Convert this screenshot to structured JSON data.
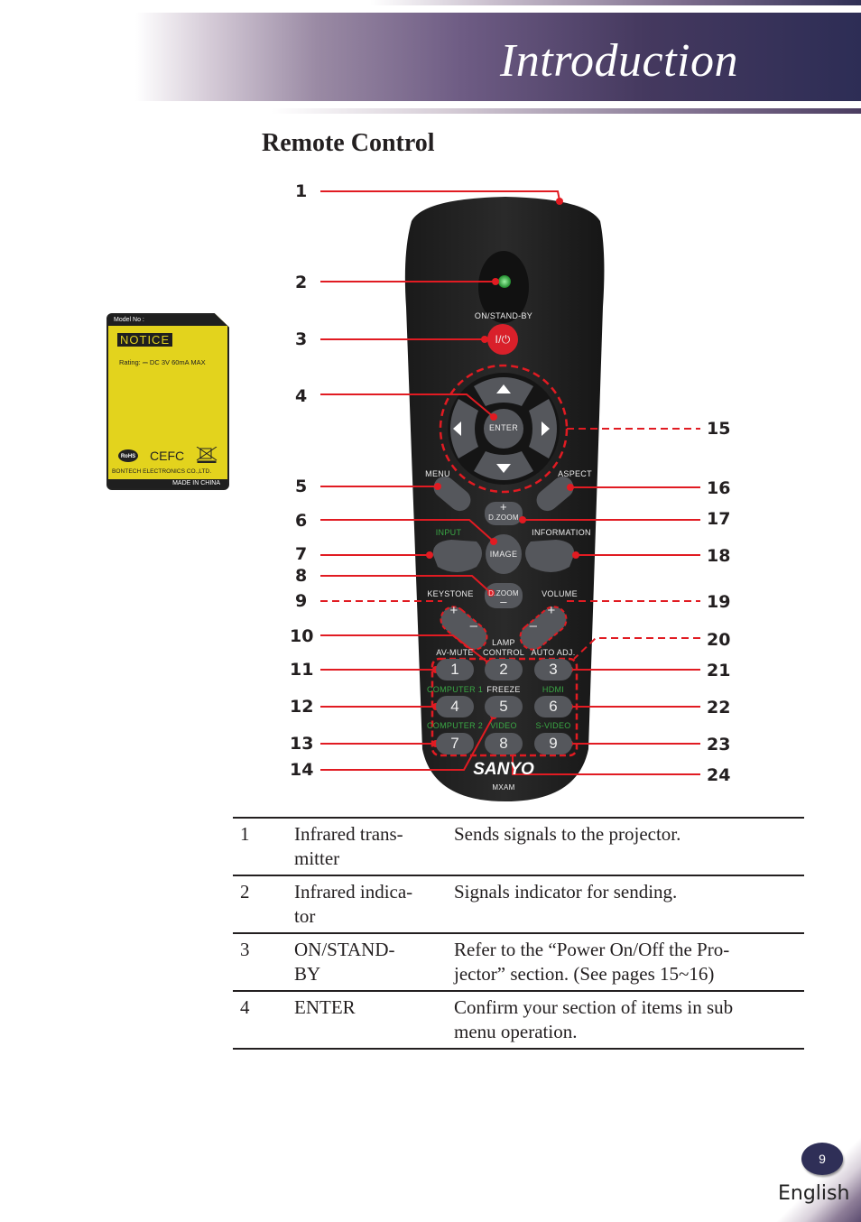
{
  "header": {
    "title": "Introduction"
  },
  "section": {
    "title": "Remote Control"
  },
  "notice_label": {
    "model_no": "Model No :",
    "notice": "NOTICE",
    "rating": "Rating: ⎓ DC 3V 60mA MAX",
    "company": "BONTECH  ELECTRONICS CO.,LTD.",
    "made_in": "MADE IN CHINA",
    "logos": [
      "RoHS",
      "CE",
      "FC",
      "WEEE bin"
    ]
  },
  "remote": {
    "power_label": "ON/STAND-BY",
    "power_symbol": "I/⏻",
    "enter": "ENTER",
    "menu": "MENU",
    "aspect": "ASPECT",
    "dzoom_plus": "D.ZOOM",
    "input": "INPUT",
    "image": "IMAGE",
    "information": "INFORMATION",
    "dzoom_minus": "D.ZOOM",
    "keystone": "KEYSTONE",
    "volume": "VOLUME",
    "lamp1": "LAMP",
    "lamp2": "CONTROL",
    "av_mute": "AV-MUTE",
    "auto_adj": "AUTO ADJ.",
    "computer1": "COMPUTER 1",
    "freeze": "FREEZE",
    "hdmi": "HDMI",
    "computer2": "COMPUTER 2",
    "video": "VIDEO",
    "svideo": "S-VIDEO",
    "digits": [
      "1",
      "2",
      "3",
      "4",
      "5",
      "6",
      "7",
      "8",
      "9"
    ],
    "brand": "SANYO",
    "model": "MXAM",
    "plus": "+",
    "minus": "–"
  },
  "callouts": {
    "left": [
      "1",
      "2",
      "3",
      "4",
      "5",
      "6",
      "7",
      "8",
      "9",
      "10",
      "11",
      "12",
      "13",
      "14"
    ],
    "right": [
      "15",
      "16",
      "17",
      "18",
      "19",
      "20",
      "21",
      "22",
      "23",
      "24"
    ]
  },
  "table": {
    "rows": [
      {
        "num": "1",
        "name": "Infrared trans-\nmitter",
        "desc": "Sends signals to the projector."
      },
      {
        "num": "2",
        "name": "Infrared indica-\ntor",
        "desc": "Signals indicator for sending."
      },
      {
        "num": "3",
        "name": "ON/STAND-\nBY",
        "desc": "Refer to the “Power On/Off the Pro-\njector” section. (See pages 15~16)"
      },
      {
        "num": "4",
        "name": "ENTER",
        "desc": "Confirm your section of items in sub\nmenu operation."
      }
    ]
  },
  "footer": {
    "page": "9",
    "language": "English"
  },
  "colors": {
    "accent_navy": "#2d2d55",
    "callout_red": "#e11b22",
    "label_yellow": "#e3d31d",
    "green_text": "#3aa845"
  }
}
